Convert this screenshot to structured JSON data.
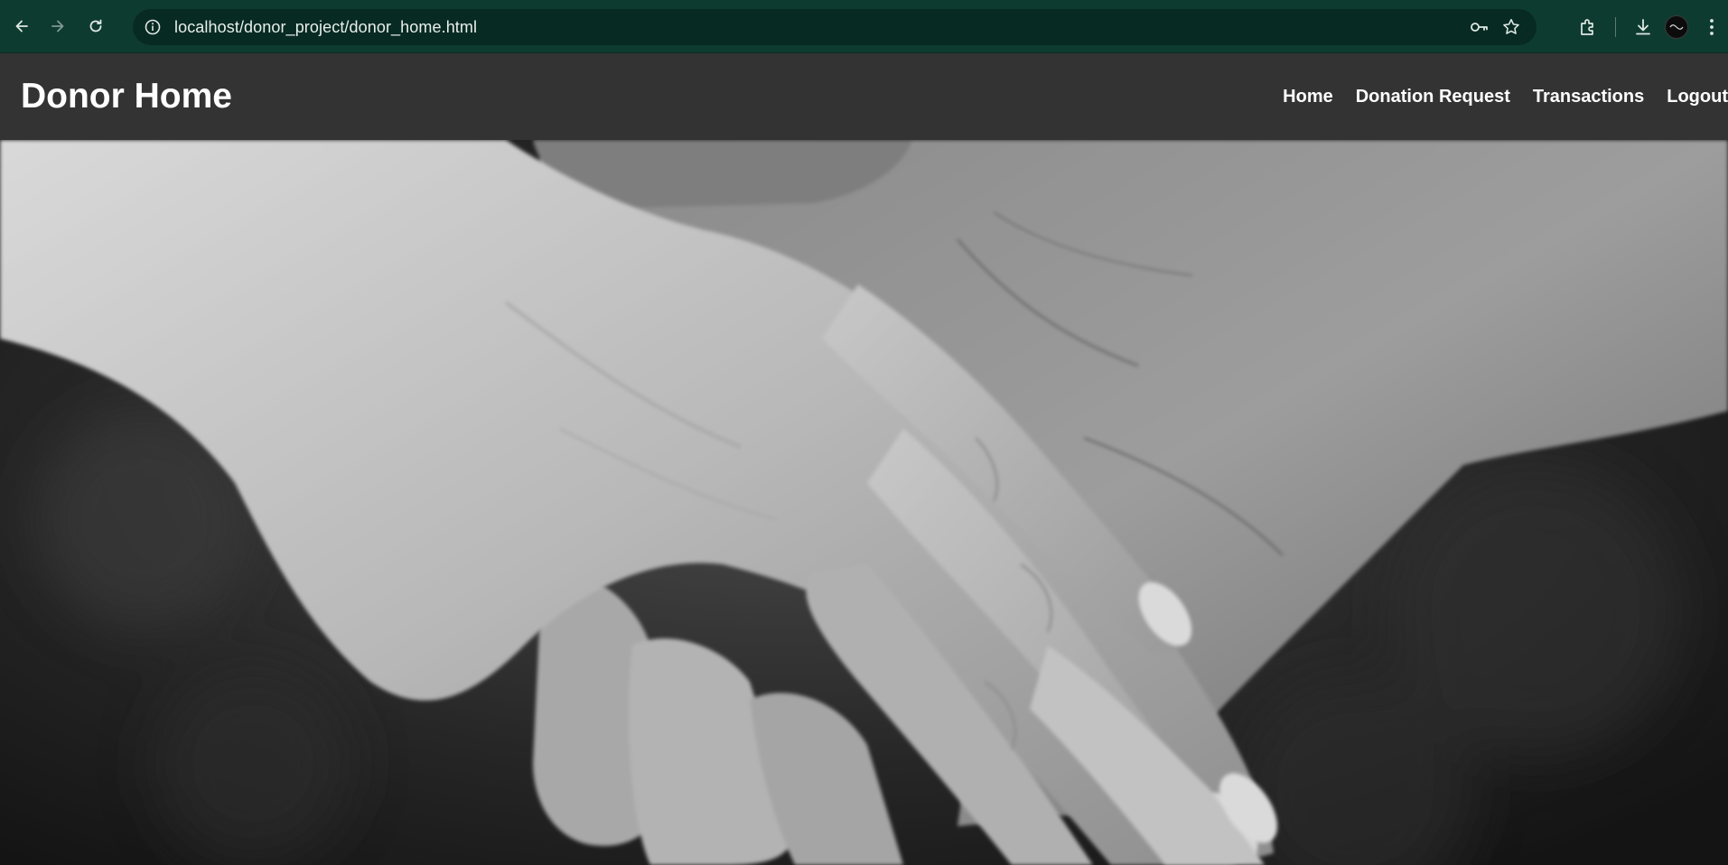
{
  "browser": {
    "url": "localhost/donor_project/donor_home.html",
    "theme_color": "#0e3b30",
    "icons": [
      "back-arrow-icon",
      "forward-arrow-icon",
      "reload-icon",
      "site-info-icon",
      "key-icon",
      "star-icon",
      "extensions-icon",
      "download-icon",
      "avatar-icon",
      "more-menu-icon"
    ]
  },
  "header": {
    "title": "Donor Home",
    "background": "#333333",
    "nav": [
      {
        "label": "Home"
      },
      {
        "label": "Donation Request"
      },
      {
        "label": "Transactions"
      },
      {
        "label": "Logout"
      }
    ]
  },
  "hero": {
    "image_icon": "clasped-hands-image",
    "tone": "grayscale"
  }
}
